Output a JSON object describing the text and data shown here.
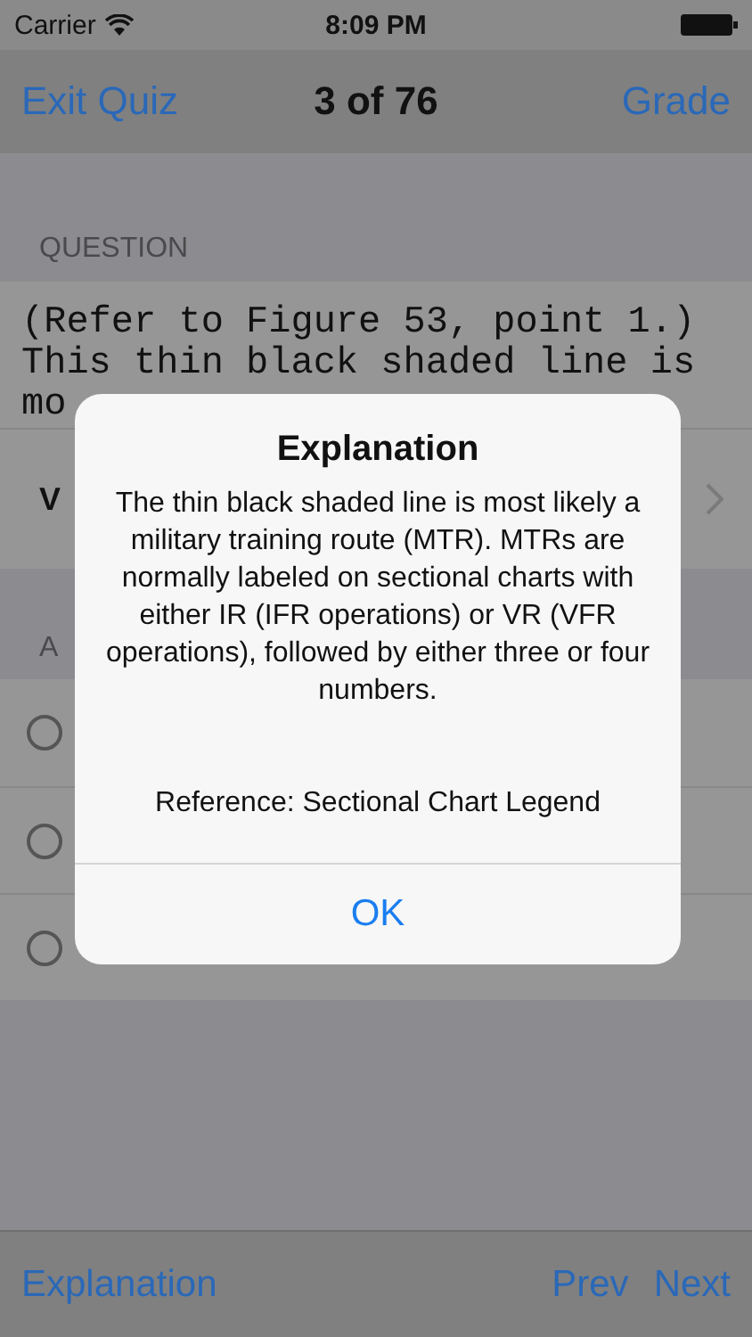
{
  "status_bar": {
    "carrier": "Carrier",
    "time": "8:09 PM"
  },
  "nav_bar": {
    "left": "Exit Quiz",
    "title": "3 of 76",
    "right": "Grade"
  },
  "question_section": {
    "header": "QUESTION",
    "lines": [
      "(Refer to Figure 53, point 1.)",
      "This thin black shaded line is",
      "mo"
    ],
    "link_row": "V"
  },
  "answers_section": {
    "header": "A",
    "answers": [
      {
        "selected": false
      },
      {
        "selected": false
      },
      {
        "selected": false
      }
    ]
  },
  "alert": {
    "title": "Explanation",
    "message": "The thin black shaded line is most likely a military training route (MTR). MTRs are normally labeled on sectional charts with either IR (IFR operations) or VR (VFR operations), followed by either three or four numbers.",
    "reference": "Reference: Sectional Chart Legend",
    "button": "OK"
  },
  "toolbar": {
    "left": "Explanation",
    "prev": "Prev",
    "next": "Next"
  }
}
